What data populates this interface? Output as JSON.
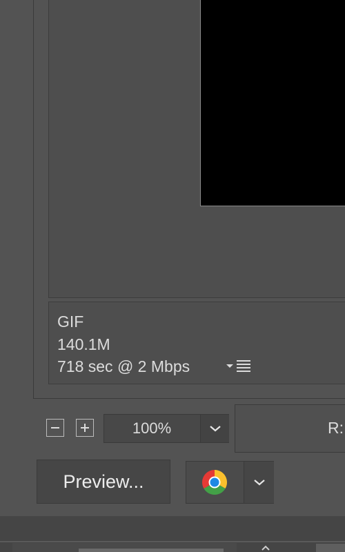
{
  "info": {
    "format": "GIF",
    "size": "140.1M",
    "download_time": "718 sec @ 2 Mbps"
  },
  "zoom": {
    "value": "100%"
  },
  "color_readout": {
    "label": "R:"
  },
  "buttons": {
    "preview": "Preview..."
  },
  "icons": {
    "zoom_out": "minus-icon",
    "zoom_in": "plus-icon",
    "zoom_dropdown": "chevron-down-icon",
    "info_menu": "list-menu-icon",
    "browser": "chrome-icon",
    "browser_dropdown": "chevron-down-icon"
  },
  "colors": {
    "background": "#535353",
    "text": "#dcdcdc",
    "preview_image": "#000000"
  }
}
